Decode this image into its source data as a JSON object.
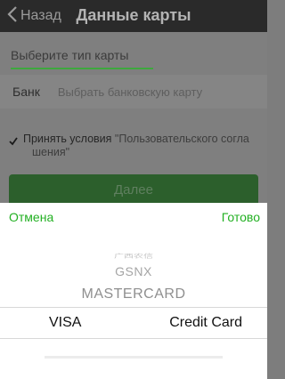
{
  "navbar": {
    "back_label": "Назад",
    "title": "Данные карты"
  },
  "form": {
    "card_type_label": "Выберите тип карты",
    "bank_label": "Банк",
    "bank_placeholder": "Выбрать банковскую карту",
    "terms_prefix": "Принять условия ",
    "terms_link_1": "\"Пользовательского согла",
    "terms_link_2": "шения\"",
    "terms_checked": true,
    "next_button": "Далее"
  },
  "picker": {
    "cancel_label": "Отмена",
    "done_label": "Готово",
    "options": [
      "广西农信",
      "GSNX",
      "MASTERCARD"
    ],
    "selected_left": "VISA",
    "selected_right": "Credit Card"
  },
  "colors": {
    "accent_green": "#22b022",
    "picker_background": "#ffffff",
    "overlay_gray": "#7d7d7d"
  }
}
